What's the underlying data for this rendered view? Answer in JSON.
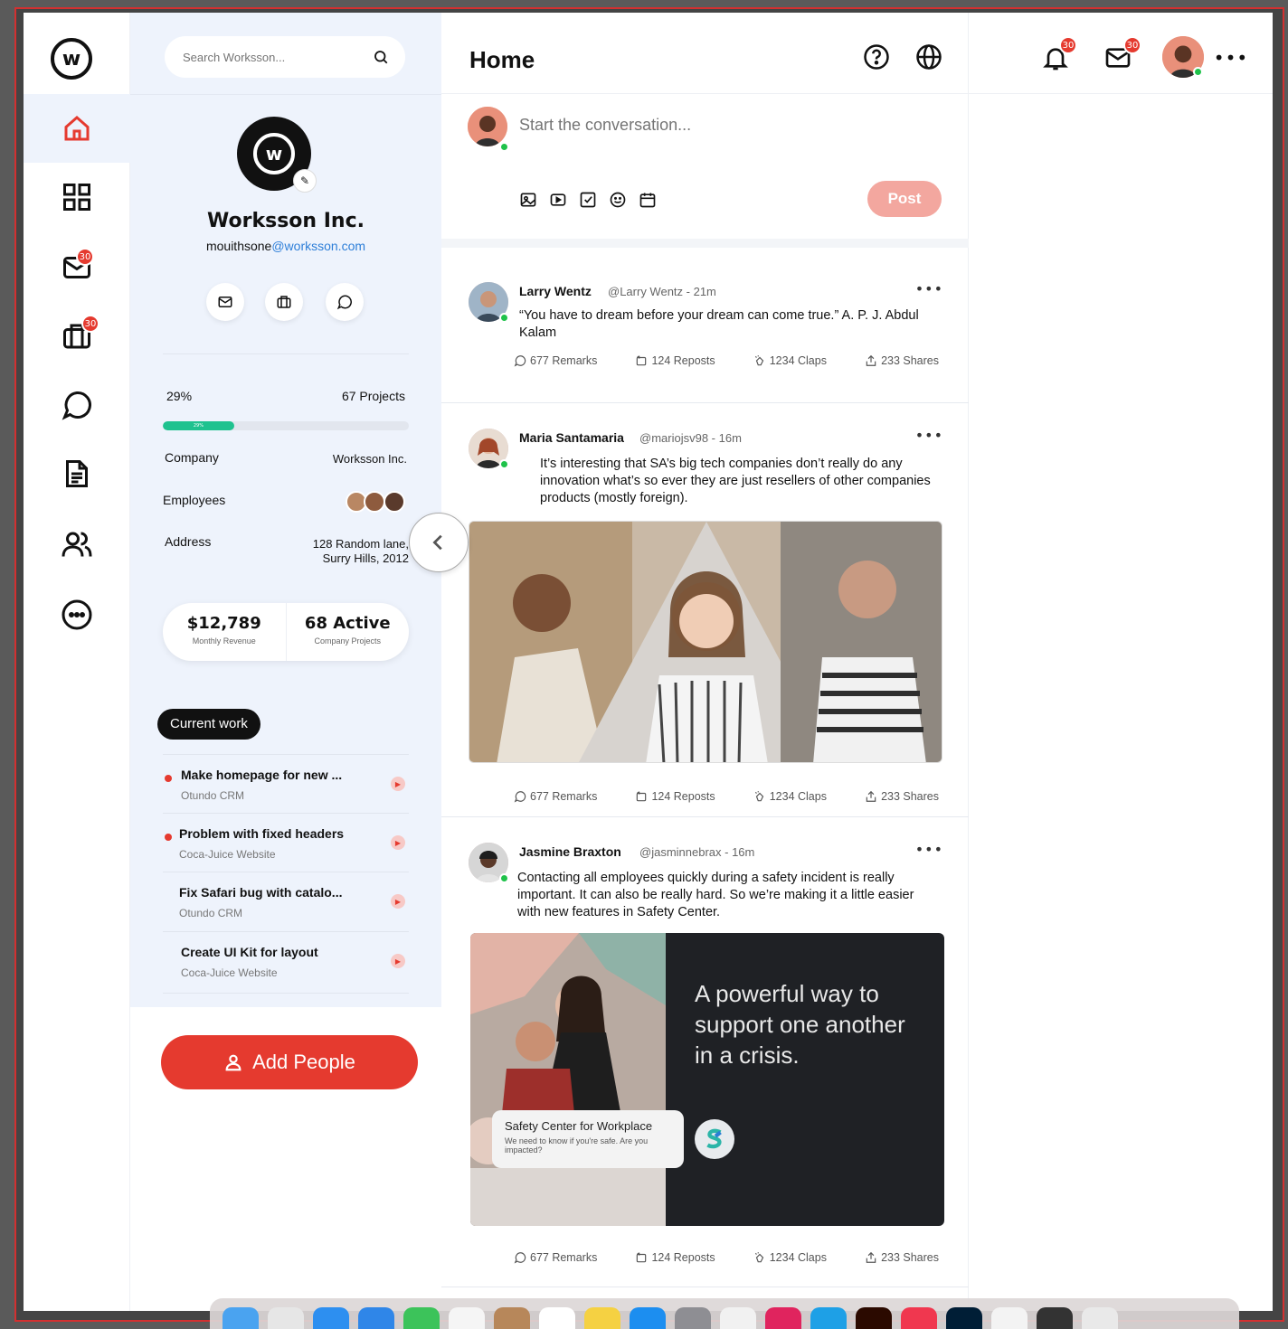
{
  "rail": {
    "items": [
      {
        "name": "home",
        "active": true
      },
      {
        "name": "dashboard"
      },
      {
        "name": "mail",
        "badge": "30"
      },
      {
        "name": "projects",
        "badge": "30"
      },
      {
        "name": "chat"
      },
      {
        "name": "documents"
      },
      {
        "name": "people"
      },
      {
        "name": "more"
      }
    ]
  },
  "search": {
    "placeholder": "Search Worksson..."
  },
  "profile": {
    "company": "Worksson Inc.",
    "email_user": "mouithsone",
    "email_domain": "@worksson.com",
    "progress_pct": "29%",
    "progress_value": 0.29,
    "progress_inner": "29%",
    "projects": "67 Projects",
    "company_label": "Company",
    "company_value": "Worksson Inc.",
    "employees_label": "Employees",
    "address_label": "Address",
    "address_line1": "128 Random lane,",
    "address_line2": "Surry Hills, 2012",
    "revenue_value": "$12,789",
    "revenue_label": "Monthly Revenue",
    "active_value": "68 Active",
    "active_label": "Company Projects"
  },
  "current_work": {
    "label": "Current work",
    "tasks": [
      {
        "title": "Make homepage for new ...",
        "sub": "Otundo CRM",
        "urgent": true
      },
      {
        "title": "Problem with fixed headers",
        "sub": "Coca-Juice Website",
        "urgent": true
      },
      {
        "title": "Fix Safari bug with catalo...",
        "sub": "Otundo CRM",
        "urgent": false
      },
      {
        "title": "Create UI Kit for layout",
        "sub": "Coca-Juice Website",
        "urgent": false
      }
    ]
  },
  "add_people": "Add People",
  "feed": {
    "title": "Home",
    "composer_placeholder": "Start the conversation...",
    "post_button": "Post",
    "posts": [
      {
        "name": "Larry Wentz",
        "handle": "@Larry Wentz - 21m",
        "body": "“You have to dream before your dream can come true.” A. P. J. Abdul Kalam",
        "remarks": "677 Remarks",
        "reposts": "124 Reposts",
        "claps": "1234 Claps",
        "shares": "233 Shares"
      },
      {
        "name": "Maria Santamaria",
        "handle": "@mariojsv98 - 16m",
        "body": "It’s interesting that SA’s big tech companies don’t really do any innovation what’s so ever they are just resellers of other companies products (mostly foreign).",
        "remarks": "677 Remarks",
        "reposts": "124 Reposts",
        "claps": "1234 Claps",
        "shares": "233 Shares"
      },
      {
        "name": "Jasmine Braxton",
        "handle": "@jasminnebrax - 16m",
        "body": "Contacting all employees quickly during a safety incident is really important. It can also be really hard. So we’re making it a little easier with new features in Safety Center.",
        "media_headline": "A powerful way to support one another in a crisis.",
        "media_card_title": "Safety Center for Workplace",
        "media_card_sub": "We need to know if you're safe. Are you impacted?",
        "remarks": "677 Remarks",
        "reposts": "124 Reposts",
        "claps": "1234 Claps",
        "shares": "233 Shares"
      }
    ]
  },
  "top_right": {
    "notif_badge": "30",
    "mail_badge": "30"
  },
  "colors": {
    "accent": "#e53a2f",
    "progress": "#1fc28f",
    "panel_bg": "#eef3fc",
    "link": "#2d7ed8"
  }
}
